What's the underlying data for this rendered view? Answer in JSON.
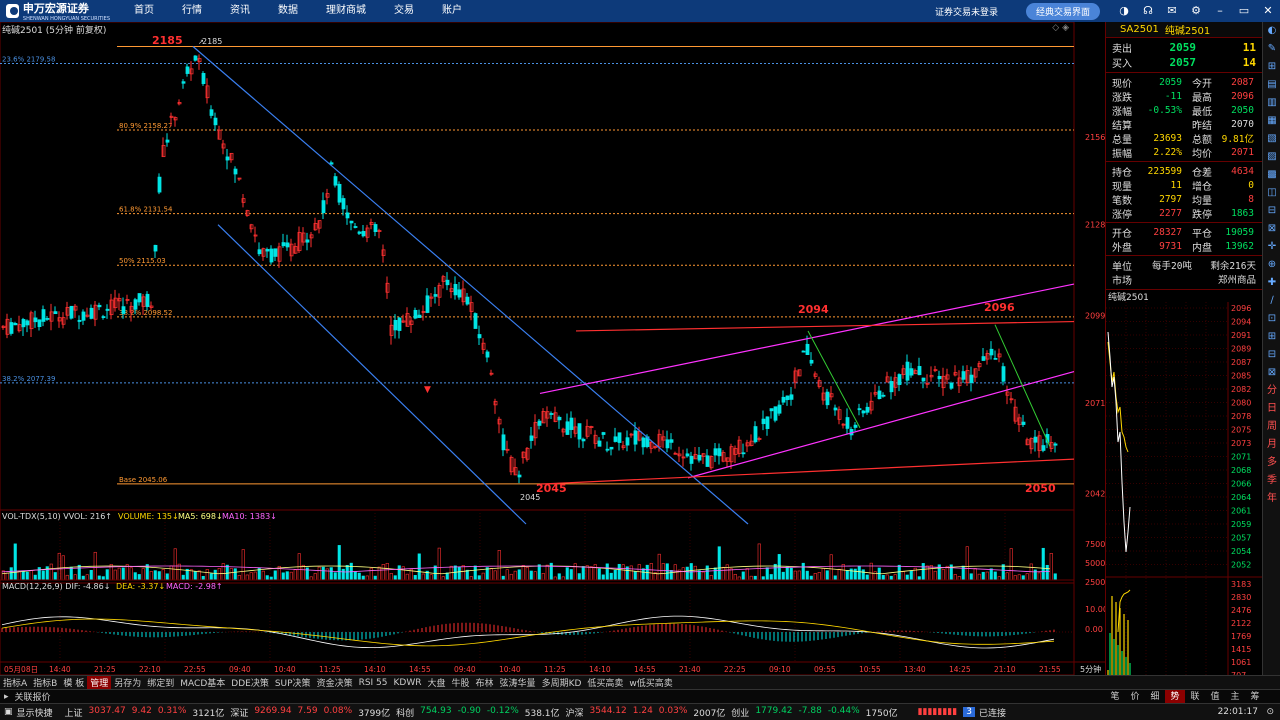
{
  "topbar": {
    "logo_text": "申万宏源证券",
    "logo_sub": "SHENWAN HONGYUAN SECURITIES",
    "nav": [
      "首页",
      "行情",
      "资讯",
      "数据",
      "理财商城",
      "交易",
      "账户"
    ],
    "login": "证券交易未登录",
    "classic_button": "经典交易界面"
  },
  "chart": {
    "title": "纯碱2501 (5分钟 前复权)",
    "fib": [
      {
        "label": "23.6% 2179.58",
        "color": "#4a90e2"
      },
      {
        "label": "80.9% 2158.27",
        "color": "#ff9933"
      },
      {
        "label": "61.8% 2131.54",
        "color": "#ff9933"
      },
      {
        "label": "50% 2115.03",
        "color": "#ff9933"
      },
      {
        "label": "38.2% 2098.52",
        "color": "#ff9933"
      },
      {
        "label": "38.2% 2077.39",
        "color": "#4a90e2"
      },
      {
        "label": "Base 2045.06",
        "color": "#ff9933"
      }
    ],
    "annotations": {
      "high": "2185",
      "high_small": "2185",
      "low": "2045",
      "low_small": "2045",
      "peak1": "2094",
      "peak2": "2096",
      "last_low": "2050"
    },
    "right_axis": [
      "2156",
      "2128",
      "2099",
      "2071",
      "2042"
    ],
    "x_ticks": [
      "05月08日",
      "14:40",
      "21:25",
      "22:10",
      "22:55",
      "09:40",
      "10:40",
      "11:25",
      "14:10",
      "14:55",
      "09:40",
      "10:40",
      "11:25",
      "14:10",
      "14:55",
      "21:40",
      "22:25",
      "09:10",
      "09:55",
      "10:55",
      "13:40",
      "14:25",
      "21:10",
      "21:55"
    ],
    "period_label": "5分钟"
  },
  "volume": {
    "header": [
      "VOL-TDX(5,10) VVOL: 216↑",
      "VOLUME: 135↓",
      "MA5: 698↓",
      "MA10: 1383↓"
    ],
    "axis": [
      "7500",
      "5000",
      "2500"
    ]
  },
  "macd": {
    "header": [
      "MACD(12,26,9) DIF: -4.86↓",
      "DEA: -3.37↓",
      "MACD: -2.98↑"
    ],
    "axis": [
      "10.00",
      "0.00"
    ]
  },
  "panel": {
    "code": "SA2501",
    "name": "纯碱2501",
    "sell": {
      "label": "卖出",
      "price": "2059",
      "qty": "11"
    },
    "buy": {
      "label": "买入",
      "price": "2057",
      "qty": "14"
    },
    "rows1": [
      [
        "现价",
        "2059",
        "今开",
        "2087"
      ],
      [
        "涨跌",
        "-11",
        "最高",
        "2096"
      ],
      [
        "涨幅",
        "-0.53%",
        "最低",
        "2050"
      ],
      [
        "结算",
        "",
        "昨结",
        "2070"
      ],
      [
        "总量",
        "23693",
        "总额",
        "9.81亿"
      ],
      [
        "振幅",
        "2.22%",
        "均价",
        "2071"
      ]
    ],
    "rows2": [
      [
        "持仓",
        "223599",
        "仓差",
        "4634"
      ],
      [
        "现量",
        "11",
        "增仓",
        "0"
      ],
      [
        "笔数",
        "2797",
        "均量",
        "8"
      ],
      [
        "涨停",
        "2277",
        "跌停",
        "1863"
      ]
    ],
    "rows3": [
      [
        "开仓",
        "28327",
        "平仓",
        "19059"
      ],
      [
        "外盘",
        "9731",
        "内盘",
        "13962"
      ]
    ],
    "unit_label": "单位",
    "unit_val": "每手20吨",
    "remain": "剩余216天",
    "market_label": "市场",
    "market_val": "郑州商品",
    "mini_title": "纯碱2501",
    "mini_axis": [
      "2096",
      "2094",
      "2091",
      "2089",
      "2087",
      "2085",
      "2082",
      "2080",
      "2078",
      "2075",
      "2073",
      "2071",
      "2068",
      "2066",
      "2064",
      "2061",
      "2059",
      "2057",
      "2054",
      "2052"
    ],
    "mini_vol_axis": [
      "3183",
      "2830",
      "2476",
      "2122",
      "1769",
      "1415",
      "1061",
      "707"
    ],
    "bottom_tabs": [
      "笔",
      "价",
      "细",
      "势",
      "联",
      "值",
      "主",
      "筹"
    ]
  },
  "right_tools": [
    "◐",
    "✎",
    "⊞",
    "▤",
    "▥",
    "▦",
    "▧",
    "▨",
    "▩",
    "◫",
    "⊟",
    "⊠",
    "✛",
    "⊕",
    "✚",
    "∕",
    "⊡",
    "⊞",
    "⊟",
    "⊠",
    "分",
    "日",
    "周",
    "月",
    "多",
    "季",
    "年"
  ],
  "bottom_tabs": [
    "指标A",
    "指标B",
    "模 板",
    "管理",
    "另存为",
    "绑定到",
    "MACD基本",
    "DDE决策",
    "SUP决策",
    "资金决策",
    "RSI 55",
    "KDWR",
    "大盘",
    "牛股",
    "布林",
    "弦涛华量",
    "多周期KD",
    "低买高卖",
    "w低买高卖"
  ],
  "assoc_label": "关联报价",
  "status": {
    "show_label": "显示快捷",
    "items": [
      {
        "name": "上证",
        "price": "3037.47",
        "chg": "9.42",
        "pct": "0.31%",
        "vol": "3121亿",
        "dir": "up"
      },
      {
        "name": "深证",
        "price": "9269.94",
        "chg": "7.59",
        "pct": "0.08%",
        "vol": "3799亿",
        "dir": "up"
      },
      {
        "name": "科创",
        "price": "754.93",
        "chg": "-0.90",
        "pct": "-0.12%",
        "vol": "538.1亿",
        "dir": "dn"
      },
      {
        "name": "沪深",
        "price": "3544.12",
        "chg": "1.24",
        "pct": "0.03%",
        "vol": "2007亿",
        "dir": "up"
      },
      {
        "name": "创业",
        "price": "1779.42",
        "chg": "-7.88",
        "pct": "-0.44%",
        "vol": "1750亿",
        "dir": "dn"
      }
    ],
    "connected": "已连接",
    "conn_num": "3",
    "time": "22:01:17"
  },
  "colors": {
    "up": "#ff3030",
    "down": "#00e5e5",
    "fib": "#ff9933",
    "channel_blue": "#3a7ff0",
    "channel_magenta": "#ff33ff",
    "red_line": "#ff3030"
  }
}
